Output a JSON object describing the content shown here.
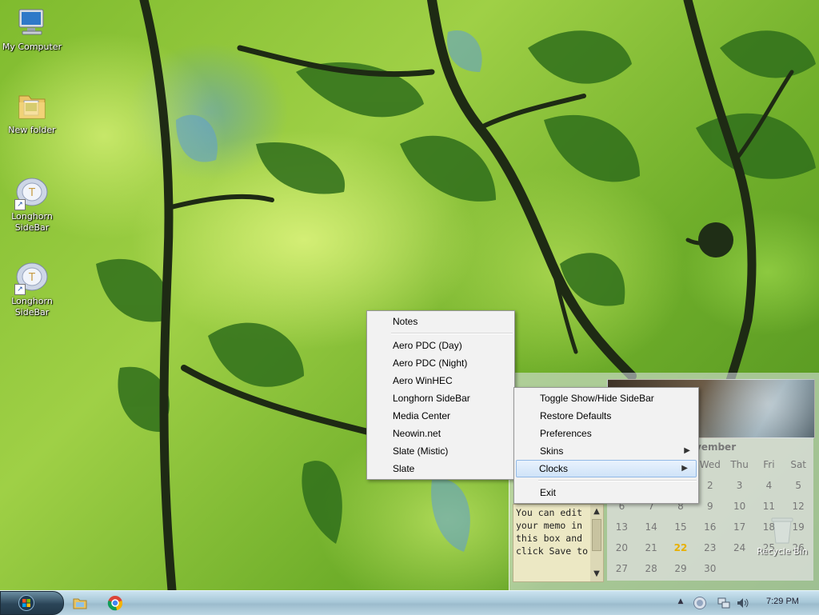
{
  "desktop": {
    "icons": [
      {
        "label": "My Computer",
        "icon": "my-computer-icon"
      },
      {
        "label": "New folder",
        "icon": "folder-icon"
      },
      {
        "label": "Longhorn\nSideBar",
        "icon": "sidebar-shortcut-icon"
      },
      {
        "label": "Longhorn\nSideBar",
        "icon": "sidebar-shortcut-icon"
      }
    ],
    "recycle_bin": {
      "label": "Recycle Bin",
      "icon": "recycle-bin-icon"
    }
  },
  "skins_menu": {
    "items": [
      {
        "label": "Notes"
      },
      {
        "label": "Aero PDC (Day)"
      },
      {
        "label": "Aero PDC (Night)"
      },
      {
        "label": "Aero WinHEC"
      },
      {
        "label": "Longhorn SideBar"
      },
      {
        "label": "Media Center"
      },
      {
        "label": "Neowin.net"
      },
      {
        "label": "Slate (Mistic)"
      },
      {
        "label": "Slate"
      }
    ]
  },
  "context_menu": {
    "items": [
      {
        "label": "Toggle Show/Hide SideBar"
      },
      {
        "label": "Restore Defaults"
      },
      {
        "label": "Preferences"
      },
      {
        "label": "Skins",
        "submenu": true
      },
      {
        "label": "Clocks",
        "submenu": true,
        "highlighted": true
      },
      {
        "label": "Exit"
      }
    ]
  },
  "sidebar": {
    "memo_text": "You can edit your memo in this box and click Save to",
    "calendar": {
      "month": "vember",
      "weekdays": [
        "",
        "",
        "Wed",
        "Thu",
        "Fri",
        "Sat"
      ],
      "weekday_cols": [
        "",
        "",
        "",
        "Wed",
        "Thu",
        "Fri",
        "Sat"
      ],
      "rows": [
        [
          "",
          "",
          "",
          "2",
          "3",
          "4",
          "5"
        ],
        [
          "6",
          "7",
          "8",
          "9",
          "10",
          "11",
          "12"
        ],
        [
          "13",
          "14",
          "15",
          "16",
          "17",
          "18",
          "19"
        ],
        [
          "20",
          "21",
          "22",
          "23",
          "24",
          "25",
          "26"
        ],
        [
          "27",
          "28",
          "29",
          "30",
          "",
          "",
          ""
        ]
      ],
      "today": "22"
    }
  },
  "taskbar": {
    "clock": "7:29 PM",
    "icons": [
      "windows-start-orb-icon",
      "explorer-icon",
      "chrome-icon"
    ],
    "tray_icons": [
      "show-hidden-icons-icon",
      "sidebar-tray-icon",
      "network-icon",
      "volume-icon"
    ]
  },
  "colors": {
    "menu_bg": "#f2f2f2",
    "highlight": "#cfe3f8",
    "today": "#e8b000"
  }
}
